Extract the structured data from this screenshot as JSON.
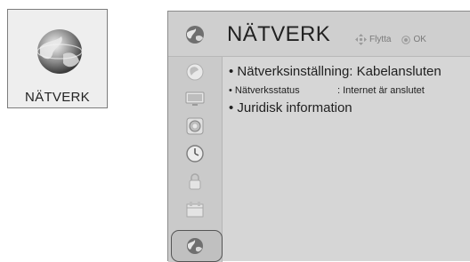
{
  "tile": {
    "label": "NÄTVERK",
    "icon": "globe-icon"
  },
  "header": {
    "title": "NÄTVERK",
    "icon": "globe-icon",
    "hint_move_icon": "move-arrows-icon",
    "hint_move": "Flytta",
    "hint_ok_icon": "ok-button-icon",
    "hint_ok": "OK"
  },
  "sidebar": {
    "items": [
      {
        "icon": "picture-icon"
      },
      {
        "icon": "screen-icon"
      },
      {
        "icon": "audio-icon"
      },
      {
        "icon": "clock-icon"
      },
      {
        "icon": "lock-icon"
      },
      {
        "icon": "options-icon"
      },
      {
        "icon": "network-icon",
        "selected": true
      }
    ]
  },
  "menu": {
    "row1": "• Nätverksinställning: Kabelansluten",
    "row2_label": "• Nätverksstatus",
    "row2_value": ": Internet är anslutet",
    "row3": "• Juridisk information"
  },
  "colors": {
    "panel": "#d6d6d6",
    "tile": "#eeeeee",
    "text": "#222222"
  }
}
